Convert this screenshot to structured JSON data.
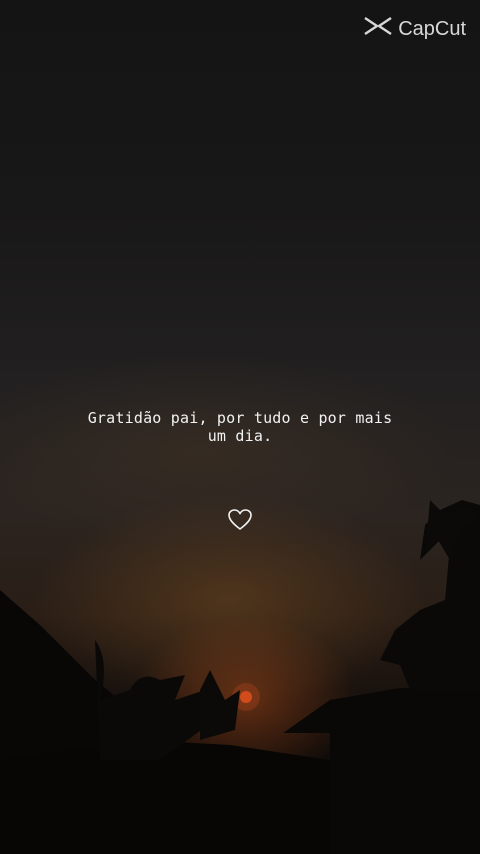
{
  "watermark": {
    "brand": "CapCut",
    "icon": "capcut-logo-icon"
  },
  "caption": {
    "line1": "Gratidão pai, por tudo e por mais",
    "line2": "um dia."
  },
  "decoration": {
    "icon": "heart-outline-icon"
  },
  "scene": {
    "description_icon": "sunset-photo"
  }
}
